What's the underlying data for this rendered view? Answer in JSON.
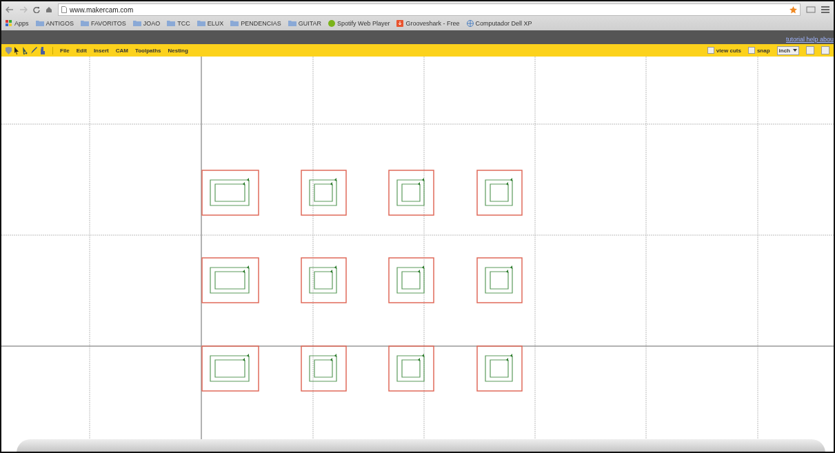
{
  "browser": {
    "url": "www.makercam.com",
    "bookmarks": [
      {
        "label": "Apps",
        "kind": "apps"
      },
      {
        "label": "ANTIGOS",
        "kind": "folder"
      },
      {
        "label": "FAVORITOS",
        "kind": "folder"
      },
      {
        "label": "JOAO",
        "kind": "folder"
      },
      {
        "label": "TCC",
        "kind": "folder"
      },
      {
        "label": "ELUX",
        "kind": "folder"
      },
      {
        "label": "PENDENCIAS",
        "kind": "folder"
      },
      {
        "label": "GUITAR",
        "kind": "folder"
      },
      {
        "label": "Spotify Web Player",
        "kind": "spotify"
      },
      {
        "label": "Grooveshark - Free",
        "kind": "grooveshark"
      },
      {
        "label": "Computador Dell XP",
        "kind": "globe"
      }
    ]
  },
  "app": {
    "top_links": "tutorial help abou",
    "menu": [
      "File",
      "Edit",
      "Insert",
      "CAM",
      "Toolpaths",
      "Nesting"
    ],
    "toggles": [
      {
        "label": "view cuts",
        "checked": false
      },
      {
        "label": "snap",
        "checked": false
      }
    ],
    "unit": "inch"
  }
}
